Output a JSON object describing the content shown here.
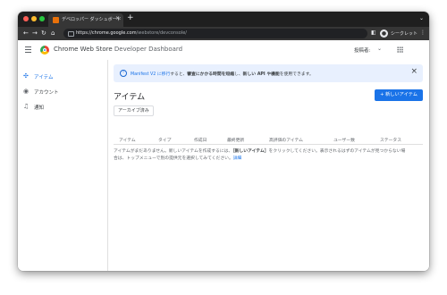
{
  "browser": {
    "tab_title": "デベロッパー ダッシュボード",
    "tab_close": "×",
    "new_tab": "+",
    "tab_menu": "⌄",
    "url_host": "https://chrome.google.com",
    "url_path": "/webstore/devconsole/",
    "profile_label": "シークレット"
  },
  "header": {
    "title_main": "Chrome Web Store",
    "title_sub": " Developer Dashboard",
    "publisher_label": "投稿者:",
    "publisher_dropdown": "⌄"
  },
  "sidebar": {
    "items": [
      {
        "label": "アイテム",
        "icon": "puzzle-icon",
        "glyph": "✣",
        "active": true
      },
      {
        "label": "アカウント",
        "icon": "account-icon",
        "glyph": "◉",
        "active": false
      },
      {
        "label": "通知",
        "icon": "bell-icon",
        "glyph": "♫",
        "active": false
      }
    ]
  },
  "banner": {
    "icon_glyph": "!",
    "link": "Manifest V2 に移行",
    "text1": "すると、",
    "bold1": "審査にかかる時間を短縮",
    "text2": "し、",
    "bold2": "新しい API や機能",
    "text3": "を使用できます。",
    "close": "×"
  },
  "main": {
    "title": "アイテム",
    "new_item_button": "+  新しいアイテム",
    "archive_button": "アーカイブ済み",
    "columns": [
      "アイテム",
      "タイプ",
      "作成日",
      "最終更新",
      "高評価のアイテム",
      "ユーザー数",
      "ステータス"
    ],
    "empty_1a": "アイテムがまだありません。新しいアイテムを作成するには、",
    "empty_1b": "［新しいアイテム］",
    "empty_1c": "をクリックしてください。表示されるはずのアイテムが見つからない場",
    "empty_2a": "合は、トップメニューで別の提供元を選択してみてください。",
    "empty_link": "詳細"
  },
  "colors": {
    "accent": "#1a73e8",
    "banner_bg": "#e8f0fe",
    "chrome_dark": "#363636"
  }
}
